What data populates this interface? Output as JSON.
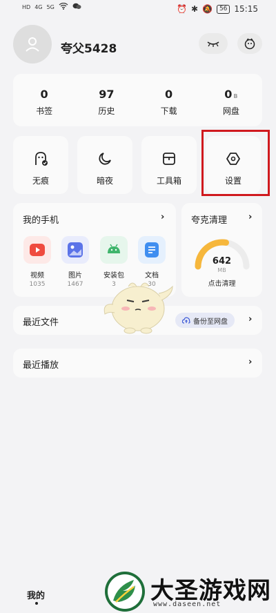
{
  "status_bar": {
    "left": [
      "HD",
      "4G",
      "5G"
    ],
    "battery": "56",
    "time": "15:15"
  },
  "profile": {
    "username": "夸父5428"
  },
  "stats": [
    {
      "value": "0",
      "label": "书签"
    },
    {
      "value": "97",
      "label": "历史"
    },
    {
      "value": "0",
      "label": "下载"
    },
    {
      "value": "0",
      "unit": "B",
      "label": "网盘"
    }
  ],
  "tools": [
    {
      "label": "无痕",
      "icon": "incognito-icon"
    },
    {
      "label": "暗夜",
      "icon": "moon-icon"
    },
    {
      "label": "工具箱",
      "icon": "toolbox-icon"
    },
    {
      "label": "设置",
      "icon": "settings-hexagon-icon"
    }
  ],
  "my_phone": {
    "title": "我的手机",
    "apps": [
      {
        "name": "视频",
        "count": "1035",
        "color": "#ef4b3f"
      },
      {
        "name": "图片",
        "count": "1467",
        "color": "#5b73e8"
      },
      {
        "name": "安装包",
        "count": "3",
        "color": "#3fb56c"
      },
      {
        "name": "文档",
        "count": "30",
        "color": "#3f8ef0"
      }
    ]
  },
  "cleaner": {
    "title": "夸克清理",
    "value": "642",
    "unit": "MB",
    "action": "点击清理",
    "fill_fraction": 0.55
  },
  "recent_files": {
    "title": "最近文件",
    "backup_label": "备份至网盘"
  },
  "recent_play": {
    "title": "最近播放"
  },
  "bottom_tab": {
    "label": "我的"
  },
  "watermark": {
    "title": "大圣游戏网",
    "url": "www.daseen.net"
  },
  "colors": {
    "accent_red": "#d0191e",
    "gauge_fill": "#f6b73c",
    "gauge_track": "#ececec"
  }
}
